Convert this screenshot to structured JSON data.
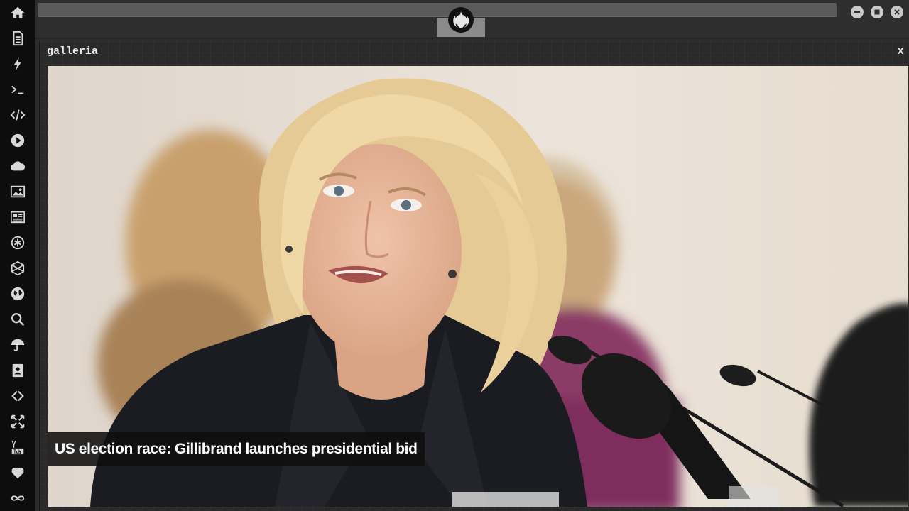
{
  "sidebar": {
    "items": [
      {
        "icon": "home-icon"
      },
      {
        "icon": "document-icon"
      },
      {
        "icon": "lightning-icon"
      },
      {
        "icon": "terminal-icon"
      },
      {
        "icon": "code-icon"
      },
      {
        "icon": "play-icon"
      },
      {
        "icon": "cloud-icon"
      },
      {
        "icon": "image-icon"
      },
      {
        "icon": "newspaper-icon"
      },
      {
        "icon": "asterisk-icon"
      },
      {
        "icon": "hexagon-icon"
      },
      {
        "icon": "globe-icon"
      },
      {
        "icon": "search-icon"
      },
      {
        "icon": "umbrella-icon"
      },
      {
        "icon": "contact-icon"
      },
      {
        "icon": "link-icon"
      },
      {
        "icon": "expand-icon"
      },
      {
        "icon": "youtube-icon"
      },
      {
        "icon": "heart-icon"
      },
      {
        "icon": "infinity-icon"
      }
    ]
  },
  "topbar": {
    "logo_icon": "rebel-alliance-icon"
  },
  "window_controls": [
    "minimize-icon",
    "maximize-icon",
    "close-icon"
  ],
  "panel": {
    "title": "galleria",
    "close_label": "x"
  },
  "gallery": {
    "caption": "US election race: Gillibrand launches presidential bid"
  },
  "colors": {
    "sidebar_bg": "#0d0d0d",
    "panel_bg": "#2a2a2a",
    "icon_color": "#d8d8d8"
  }
}
